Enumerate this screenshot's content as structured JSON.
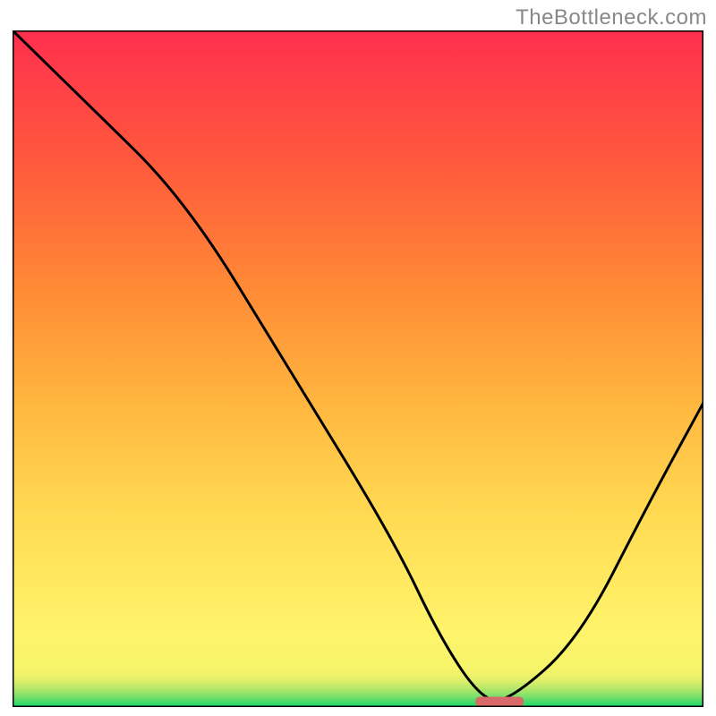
{
  "watermark": "TheBottleneck.com",
  "chart_data": {
    "type": "line",
    "title": "",
    "xlabel": "",
    "ylabel": "",
    "xlim": [
      0,
      100
    ],
    "ylim": [
      0,
      100
    ],
    "series": [
      {
        "name": "bottleneck-curve",
        "x": [
          0,
          10,
          25,
          40,
          55,
          62,
          68,
          72,
          82,
          92,
          100
        ],
        "y": [
          100,
          90,
          75,
          50,
          25,
          10,
          1,
          1,
          10,
          30,
          45
        ]
      }
    ],
    "marker": {
      "name": "optimal-range",
      "x_start": 67,
      "x_end": 74,
      "y": 0.8
    },
    "gradient_stops": [
      {
        "offset": 0.0,
        "color": "#12d66b"
      },
      {
        "offset": 0.015,
        "color": "#78e06a"
      },
      {
        "offset": 0.028,
        "color": "#b7e769"
      },
      {
        "offset": 0.04,
        "color": "#e3f06a"
      },
      {
        "offset": 0.055,
        "color": "#f6f56a"
      },
      {
        "offset": 0.12,
        "color": "#fff36a"
      },
      {
        "offset": 0.28,
        "color": "#ffdb52"
      },
      {
        "offset": 0.45,
        "color": "#ffb63f"
      },
      {
        "offset": 0.62,
        "color": "#ff8a35"
      },
      {
        "offset": 0.8,
        "color": "#ff5a3c"
      },
      {
        "offset": 1.0,
        "color": "#ff2f4e"
      }
    ],
    "colors": {
      "curve_stroke": "#000000",
      "marker_fill": "#d96a6a",
      "border": "#000000"
    },
    "border_width": 3,
    "curve_width": 3
  }
}
